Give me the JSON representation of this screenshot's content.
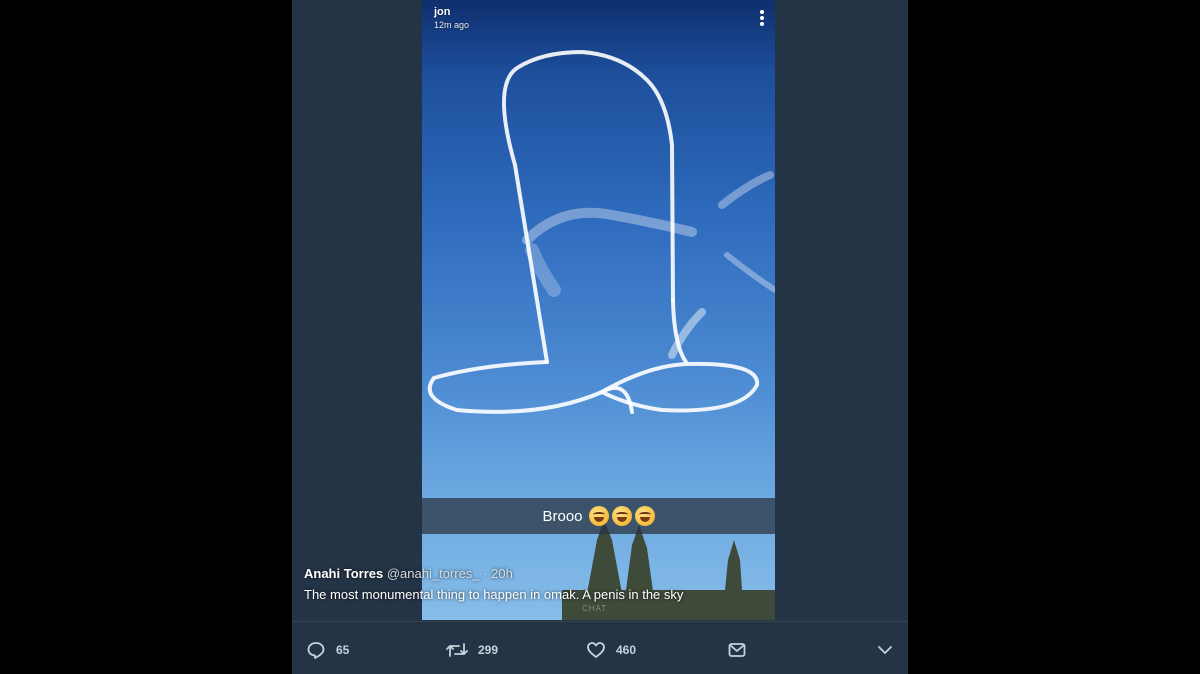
{
  "story": {
    "username": "jon",
    "timestamp": "12m ago",
    "caption": "Brooo",
    "caption_emojis": [
      "laughing-emoji",
      "laughing-emoji",
      "laughing-emoji"
    ],
    "chat_label": "CHAT",
    "menu_icon": "more-vertical-icon"
  },
  "tweet": {
    "author_name": "Anahi Torres",
    "author_handle": "@anahi_torres_",
    "time": "· 20h",
    "text": "The most monumental thing to happen in omak. A penis in the sky"
  },
  "actions": {
    "reply": {
      "icon": "reply-icon",
      "count": "65"
    },
    "retweet": {
      "icon": "retweet-icon",
      "count": "299"
    },
    "like": {
      "icon": "heart-icon",
      "count": "460"
    },
    "message": {
      "icon": "envelope-icon"
    },
    "more": {
      "icon": "chevron-down-icon"
    }
  },
  "colors": {
    "background": "#000000",
    "tweet_background": "#243447",
    "sky_top": "#0f2f6e",
    "sky_bottom": "#86bde9"
  }
}
